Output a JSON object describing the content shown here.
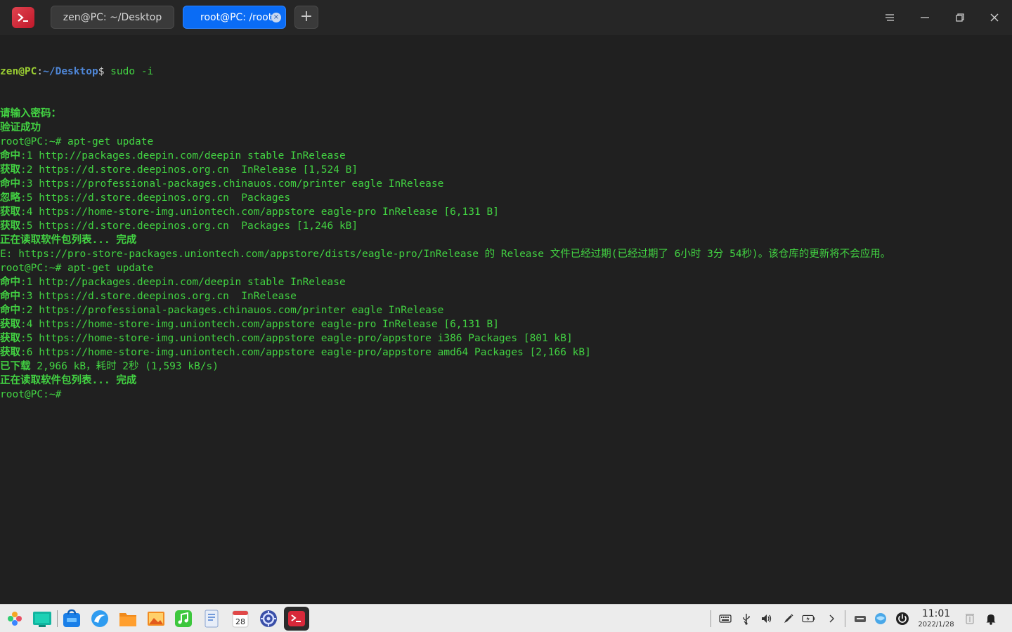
{
  "titlebar": {
    "tabs": [
      {
        "label": "zen@PC: ~/Desktop",
        "active": false
      },
      {
        "label": "root@PC: /root",
        "active": true
      }
    ],
    "new_tab": "+",
    "close_tab": "×"
  },
  "terminal": {
    "first_prompt": {
      "user": "zen@PC",
      "sep": ":",
      "path": "~/Desktop",
      "symbol": "$",
      "command": " sudo -i"
    },
    "lines": [
      {
        "text": "请输入密码：",
        "cjk": true
      },
      {
        "text": "验证成功",
        "cjk": true
      },
      {
        "text": "root@PC:~# apt-get update"
      },
      {
        "prefix": "命中",
        "text": ":1 http://packages.deepin.com/deepin stable InRelease"
      },
      {
        "prefix": "获取",
        "text": ":2 https://d.store.deepinos.org.cn  InRelease [1,524 B]"
      },
      {
        "prefix": "命中",
        "text": ":3 https://professional-packages.chinauos.com/printer eagle InRelease"
      },
      {
        "prefix": "忽略",
        "text": ":5 https://d.store.deepinos.org.cn  Packages"
      },
      {
        "prefix": "获取",
        "text": ":4 https://home-store-img.uniontech.com/appstore eagle-pro InRelease [6,131 B]"
      },
      {
        "prefix": "获取",
        "text": ":5 https://d.store.deepinos.org.cn  Packages [1,246 kB]"
      },
      {
        "text": "正在读取软件包列表... 完成",
        "cjk": true
      },
      {
        "text": "E: https://pro-store-packages.uniontech.com/appstore/dists/eagle-pro/InRelease 的 Release 文件已经过期(已经过期了 6小时 3分 54秒)。该仓库的更新将不会应用。"
      },
      {
        "text": "root@PC:~# apt-get update"
      },
      {
        "prefix": "命中",
        "text": ":1 http://packages.deepin.com/deepin stable InRelease"
      },
      {
        "prefix": "命中",
        "text": ":3 https://d.store.deepinos.org.cn  InRelease"
      },
      {
        "prefix": "命中",
        "text": ":2 https://professional-packages.chinauos.com/printer eagle InRelease"
      },
      {
        "prefix": "获取",
        "text": ":4 https://home-store-img.uniontech.com/appstore eagle-pro InRelease [6,131 B]"
      },
      {
        "prefix": "获取",
        "text": ":5 https://home-store-img.uniontech.com/appstore eagle-pro/appstore i386 Packages [801 kB]"
      },
      {
        "prefix": "获取",
        "text": ":6 https://home-store-img.uniontech.com/appstore eagle-pro/appstore amd64 Packages [2,166 kB]"
      },
      {
        "prefix": "已下载",
        "text": " 2,966 kB，耗时 2秒 (1,593 kB/s)"
      },
      {
        "text": "正在读取软件包列表... 完成",
        "cjk": true
      },
      {
        "text": "root@PC:~#"
      }
    ]
  },
  "taskbar": {
    "clock_time": "11:01",
    "clock_date": "2022/1/28",
    "calendar_day": "28"
  },
  "colors": {
    "terminal_text": "#42d242",
    "prompt_user": "#9acd32",
    "prompt_path": "#4f87d8",
    "active_tab": "#0a6cf5"
  }
}
